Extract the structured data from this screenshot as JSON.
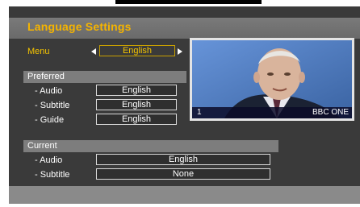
{
  "header": {
    "title": "Language Settings"
  },
  "menu": {
    "label": "Menu",
    "value": "English"
  },
  "preferred": {
    "heading": "Preferred",
    "rows": [
      {
        "label": "- Audio",
        "value": "English"
      },
      {
        "label": "- Subtitle",
        "value": "English"
      },
      {
        "label": "- Guide",
        "value": "English"
      }
    ]
  },
  "current": {
    "heading": "Current",
    "rows": [
      {
        "label": "- Audio",
        "value": "English"
      },
      {
        "label": "- Subtitle",
        "value": "None"
      }
    ]
  },
  "preview": {
    "channel_number": "1",
    "channel_name": "BBC ONE"
  },
  "colors": {
    "accent": "#f5b400",
    "panel": "#3a3a3a",
    "band": "#7d7d7d"
  }
}
